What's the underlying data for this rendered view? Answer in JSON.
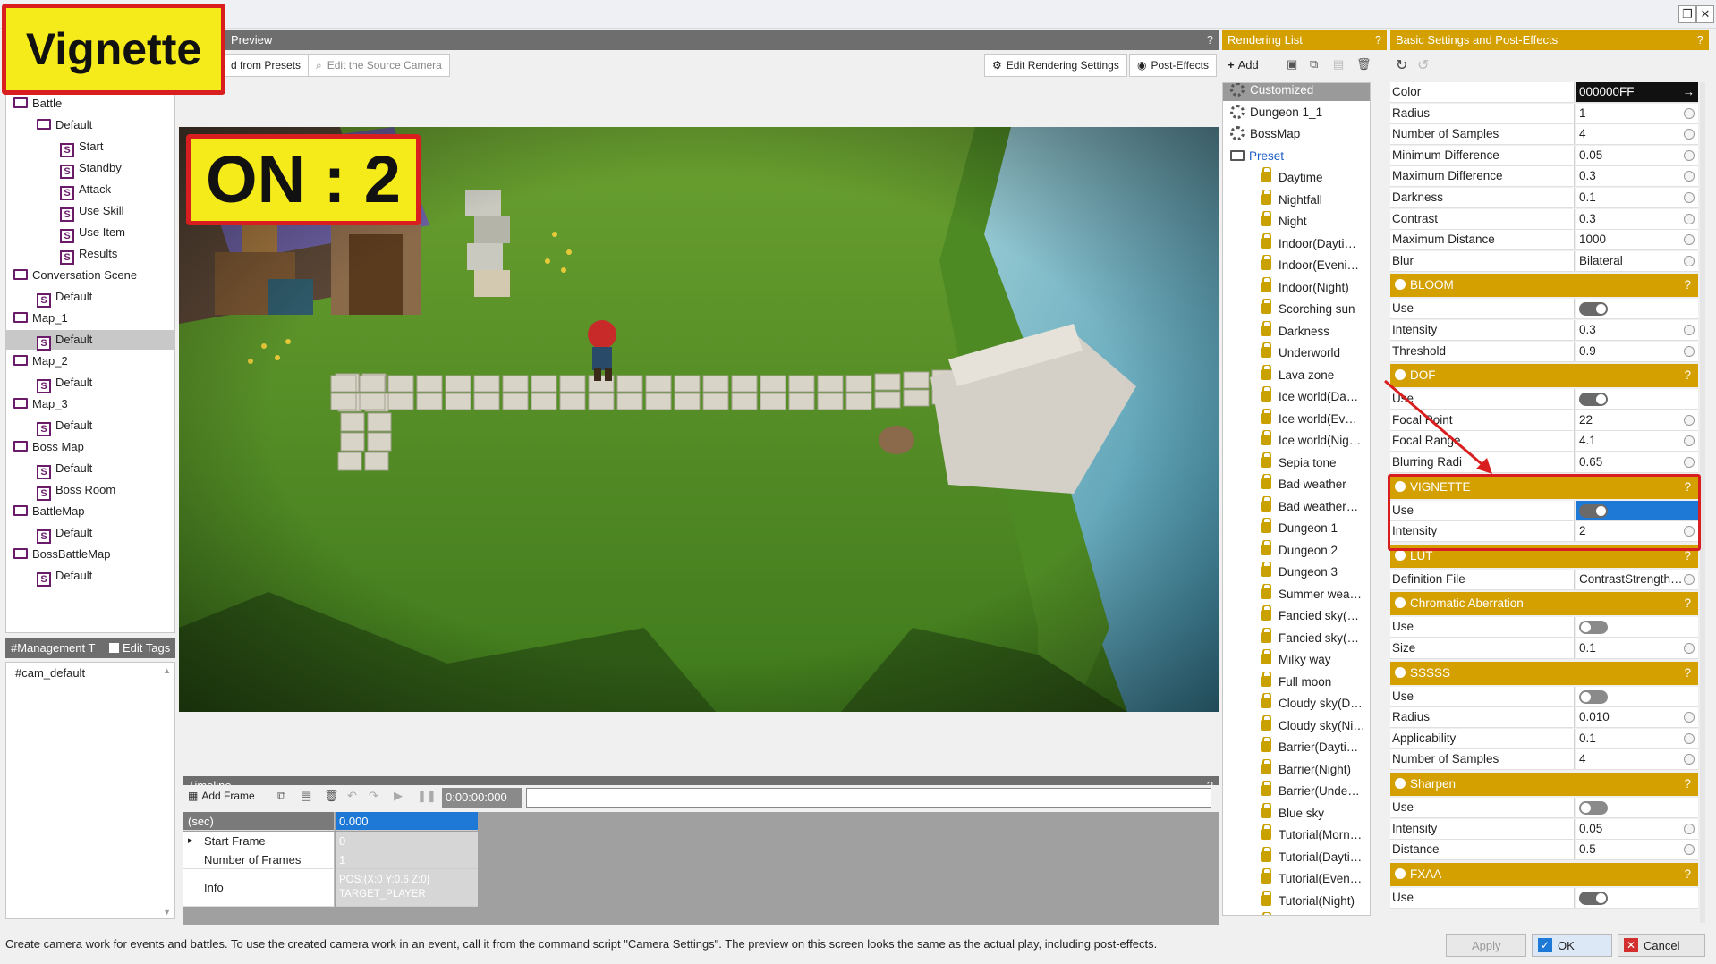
{
  "annotations": {
    "title": "Vignette",
    "badge": "ON : 2"
  },
  "preview": {
    "header": "Preview",
    "toolbar": {
      "load_presets": "d from Presets",
      "edit_source_camera": "Edit the Source Camera",
      "edit_rendering": "Edit Rendering Settings",
      "post_effects": "Post-Effects"
    }
  },
  "tree": {
    "items": [
      {
        "label": "Default",
        "type": "folder"
      },
      {
        "label": "Battle",
        "type": "folder"
      },
      {
        "label": "Default",
        "type": "folder"
      },
      {
        "label": "Start",
        "type": "script"
      },
      {
        "label": "Standby",
        "type": "script"
      },
      {
        "label": "Attack",
        "type": "script"
      },
      {
        "label": "Use Skill",
        "type": "script"
      },
      {
        "label": "Use Item",
        "type": "script"
      },
      {
        "label": "Results",
        "type": "script"
      },
      {
        "label": "Conversation Scene",
        "type": "folder"
      },
      {
        "label": "Default",
        "type": "script"
      },
      {
        "label": "Map_1",
        "type": "folder"
      },
      {
        "label": "Default",
        "type": "script",
        "selected": true
      },
      {
        "label": "Map_2",
        "type": "folder"
      },
      {
        "label": "Default",
        "type": "script"
      },
      {
        "label": "Map_3",
        "type": "folder"
      },
      {
        "label": "Default",
        "type": "script"
      },
      {
        "label": "Boss Map",
        "type": "folder"
      },
      {
        "label": "Default",
        "type": "script"
      },
      {
        "label": "Boss Room",
        "type": "script"
      },
      {
        "label": "BattleMap",
        "type": "folder"
      },
      {
        "label": "Default",
        "type": "script"
      },
      {
        "label": "BossBattleMap",
        "type": "folder"
      },
      {
        "label": "Default",
        "type": "script"
      }
    ]
  },
  "tags": {
    "header": "#Management T",
    "edit_tags": "Edit Tags",
    "items": [
      "#cam_default"
    ]
  },
  "timeline": {
    "header": "Timeline",
    "add_frame": "Add Frame",
    "time": "0:00:00:000",
    "rows": [
      {
        "key": "(sec)",
        "value": "0.000"
      },
      {
        "key": "Start Frame",
        "value": "0"
      },
      {
        "key": "Number of Frames",
        "value": "1"
      },
      {
        "key": "Info",
        "value": "POS:{X:0 Y:0.6 Z:0}",
        "value2": "TARGET_PLAYER"
      }
    ]
  },
  "rendering_list": {
    "header": "Rendering List",
    "add": "Add",
    "items": [
      {
        "label": "Customized",
        "icon": "gear",
        "selected": true
      },
      {
        "label": "Dungeon 1_1",
        "icon": "gear"
      },
      {
        "label": "BossMap",
        "icon": "gear"
      },
      {
        "label": "Preset",
        "icon": "folder",
        "accent": true
      },
      {
        "label": "Daytime",
        "icon": "lock"
      },
      {
        "label": "Nightfall",
        "icon": "lock"
      },
      {
        "label": "Night",
        "icon": "lock"
      },
      {
        "label": "Indoor(Dayti…",
        "icon": "lock"
      },
      {
        "label": "Indoor(Eveni…",
        "icon": "lock"
      },
      {
        "label": "Indoor(Night)",
        "icon": "lock"
      },
      {
        "label": "Scorching sun",
        "icon": "lock"
      },
      {
        "label": "Darkness",
        "icon": "lock"
      },
      {
        "label": "Underworld",
        "icon": "lock"
      },
      {
        "label": "Lava zone",
        "icon": "lock"
      },
      {
        "label": "Ice world(Da…",
        "icon": "lock"
      },
      {
        "label": "Ice world(Ev…",
        "icon": "lock"
      },
      {
        "label": "Ice world(Nig…",
        "icon": "lock"
      },
      {
        "label": "Sepia tone",
        "icon": "lock"
      },
      {
        "label": "Bad weather",
        "icon": "lock"
      },
      {
        "label": "Bad weather…",
        "icon": "lock"
      },
      {
        "label": "Dungeon 1",
        "icon": "lock"
      },
      {
        "label": "Dungeon 2",
        "icon": "lock"
      },
      {
        "label": "Dungeon 3",
        "icon": "lock"
      },
      {
        "label": "Summer wea…",
        "icon": "lock"
      },
      {
        "label": "Fancied sky(…",
        "icon": "lock"
      },
      {
        "label": "Fancied sky(…",
        "icon": "lock"
      },
      {
        "label": "Milky way",
        "icon": "lock"
      },
      {
        "label": "Full moon",
        "icon": "lock"
      },
      {
        "label": "Cloudy sky(D…",
        "icon": "lock"
      },
      {
        "label": "Cloudy sky(Ni…",
        "icon": "lock"
      },
      {
        "label": "Barrier(Dayti…",
        "icon": "lock"
      },
      {
        "label": "Barrier(Night)",
        "icon": "lock"
      },
      {
        "label": "Barrier(Unde…",
        "icon": "lock"
      },
      {
        "label": "Blue sky",
        "icon": "lock"
      },
      {
        "label": "Tutorial(Morn…",
        "icon": "lock"
      },
      {
        "label": "Tutorial(Dayti…",
        "icon": "lock"
      },
      {
        "label": "Tutorial(Even…",
        "icon": "lock"
      },
      {
        "label": "Tutorial(Night)",
        "icon": "lock"
      },
      {
        "label": "Tutorial(UV n…",
        "icon": "lock"
      }
    ]
  },
  "settings": {
    "header": "Basic Settings and Post-Effects",
    "blocks": [
      {
        "type": "row",
        "key": "Color",
        "value": "000000FF",
        "dark": true
      },
      {
        "type": "row",
        "key": "Radius",
        "value": "1"
      },
      {
        "type": "row",
        "key": "Number of Samples",
        "value": "4"
      },
      {
        "type": "row",
        "key": "Minimum Difference",
        "value": "0.05"
      },
      {
        "type": "row",
        "key": "Maximum Difference",
        "value": "0.3"
      },
      {
        "type": "row",
        "key": "Darkness",
        "value": "0.1"
      },
      {
        "type": "row",
        "key": "Contrast",
        "value": "0.3"
      },
      {
        "type": "row",
        "key": "Maximum Distance",
        "value": "1000"
      },
      {
        "type": "row",
        "key": "Blur",
        "value": "Bilateral"
      },
      {
        "type": "section",
        "label": "BLOOM"
      },
      {
        "type": "toggle",
        "key": "Use",
        "on": true
      },
      {
        "type": "row",
        "key": "Intensity",
        "value": "0.3"
      },
      {
        "type": "row",
        "key": "Threshold",
        "value": "0.9"
      },
      {
        "type": "section",
        "label": "DOF"
      },
      {
        "type": "toggle",
        "key": "Use",
        "on": true
      },
      {
        "type": "row",
        "key": "Focal Point",
        "value": "22"
      },
      {
        "type": "row",
        "key": "Focal Range",
        "value": "4.1"
      },
      {
        "type": "row",
        "key": "Blurring Radi",
        "value": "0.65"
      },
      {
        "type": "section",
        "label": "VIGNETTE"
      },
      {
        "type": "toggle",
        "key": "Use",
        "on": true,
        "highlight": true
      },
      {
        "type": "row",
        "key": "Intensity",
        "value": "2"
      },
      {
        "type": "section",
        "label": "LUT"
      },
      {
        "type": "row",
        "key": "Definition File",
        "value": "ContrastStrength…"
      },
      {
        "type": "section",
        "label": "Chromatic Aberration"
      },
      {
        "type": "toggle",
        "key": "Use",
        "on": false
      },
      {
        "type": "row",
        "key": "Size",
        "value": "0.1"
      },
      {
        "type": "section",
        "label": "SSSSS"
      },
      {
        "type": "toggle",
        "key": "Use",
        "on": false
      },
      {
        "type": "row",
        "key": "Radius",
        "value": "0.010"
      },
      {
        "type": "row",
        "key": "Applicability",
        "value": "0.1"
      },
      {
        "type": "row",
        "key": "Number of Samples",
        "value": "4"
      },
      {
        "type": "section",
        "label": "Sharpen"
      },
      {
        "type": "toggle",
        "key": "Use",
        "on": false
      },
      {
        "type": "row",
        "key": "Intensity",
        "value": "0.05"
      },
      {
        "type": "row",
        "key": "Distance",
        "value": "0.5"
      },
      {
        "type": "section",
        "label": "FXAA"
      },
      {
        "type": "toggle",
        "key": "Use",
        "on": true
      }
    ]
  },
  "status": "Create camera work for events and battles. To use the created camera work in an event, call it from the command script \"Camera Settings\". The preview on this screen looks the same as the actual play, including post-effects.",
  "buttons": {
    "apply": "Apply",
    "ok": "OK",
    "cancel": "Cancel"
  },
  "colors": {
    "gold": "#d4a000",
    "annotation_red": "#d81e1e",
    "annotation_yellow": "#f5ea1a",
    "selection_blue": "#1e78d6"
  }
}
